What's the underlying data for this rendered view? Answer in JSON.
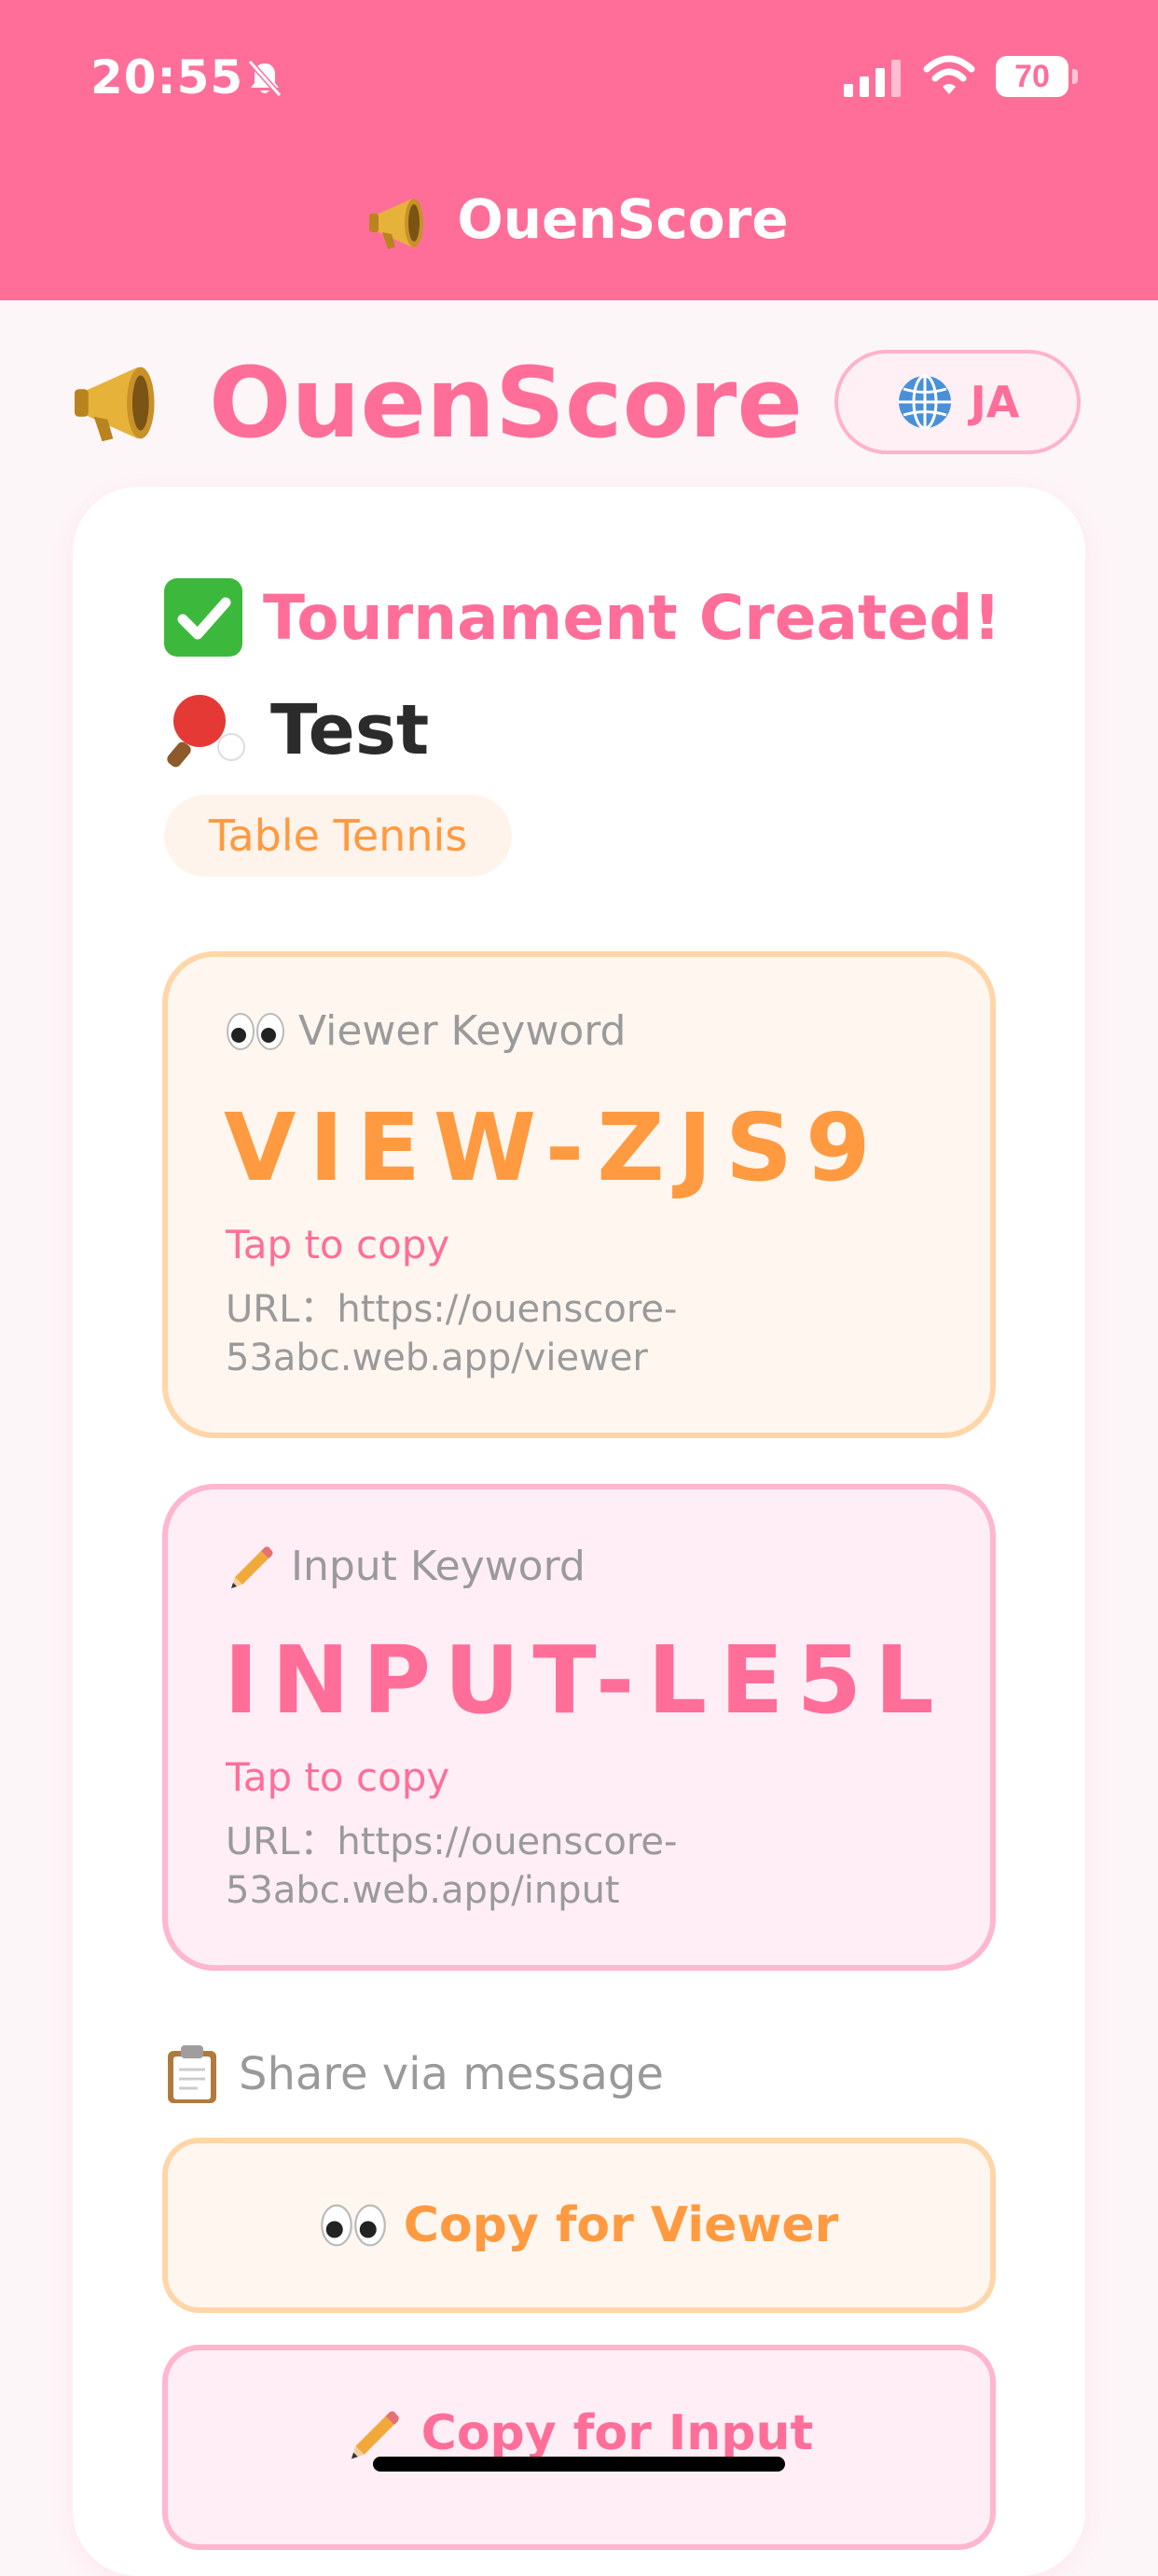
{
  "status_bar": {
    "time": "20:55",
    "battery": "70"
  },
  "nav": {
    "title": "OuenScore"
  },
  "header": {
    "brand": "OuenScore",
    "language": "JA"
  },
  "result": {
    "created_title": "Tournament Created!",
    "tournament_name": "Test",
    "sport": "Table Tennis"
  },
  "viewer_keyword": {
    "label": "Viewer Keyword",
    "code": "VIEW-ZJS9",
    "tap_hint": "Tap to copy",
    "url": "URL：https://​ouenscore-53abc.web.app/viewer"
  },
  "input_keyword": {
    "label": "Input Keyword",
    "code": "INPUT-LE5L",
    "tap_hint": "Tap to copy",
    "url": "URL：https://​ouenscore-53abc.web.app/input"
  },
  "share": {
    "label": "Share via message",
    "copy_viewer": "Copy for Viewer",
    "copy_input": "Copy for Input"
  },
  "colors": {
    "brand_pink": "#ff6e99",
    "accent_orange": "#ff9a40"
  }
}
